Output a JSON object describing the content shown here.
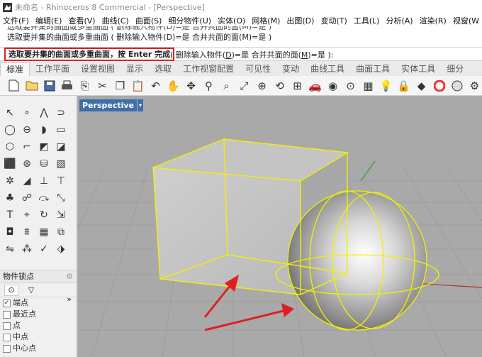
{
  "app": {
    "title": "未命名 - Rhinoceros 8 Commercial - [Perspective]"
  },
  "menu": {
    "items": [
      "文件(F)",
      "编辑(E)",
      "查看(V)",
      "曲线(C)",
      "曲面(S)",
      "细分物件(U)",
      "实体(O)",
      "网格(M)",
      "出图(D)",
      "变动(T)",
      "工具(L)",
      "分析(A)",
      "渲染(R)",
      "视窗(W"
    ]
  },
  "history": {
    "lines": [
      "选取要并集的曲面或多重曲面 ( 删除输入物件(D)=是  合并共面的面(M)=是 )",
      "选取要并集的曲面或多重曲面 ( 删除输入物件(D)=是  合并共面的面(M)=是 )"
    ]
  },
  "command": {
    "prompt": "选取要并集的曲面或多重曲面，按 Enter 完成",
    "opt1_pre": "( 删除输入物件(",
    "opt1_key": "D",
    "opt1_post": ")=是",
    "opt2_pre": "  合并共面的面(",
    "opt2_key": "M",
    "opt2_post": ")=是 ):"
  },
  "tabs": [
    "标准",
    "工作平面",
    "设置视图",
    "显示",
    "选取",
    "工作视窗配置",
    "可见性",
    "变动",
    "曲线工具",
    "曲面工具",
    "实体工具",
    "细分"
  ],
  "active_tab": "标准",
  "viewport": {
    "label": "Perspective",
    "dropdown": "▾"
  },
  "osnap": {
    "title": "物件锁点",
    "gear": "⚙",
    "subtabs": [
      "⊙",
      "▽"
    ],
    "items": [
      {
        "label": "端点",
        "checked": true
      },
      {
        "label": "最近点",
        "checked": false
      },
      {
        "label": "点",
        "checked": false
      },
      {
        "label": "中点",
        "checked": false
      },
      {
        "label": "中心点",
        "checked": false
      }
    ],
    "expand": "»"
  },
  "colors": {
    "selection": "#f2f000",
    "arrow": "#e02020",
    "viewport_bg": "#a9a9a9",
    "grid": "#9a9a9a"
  }
}
